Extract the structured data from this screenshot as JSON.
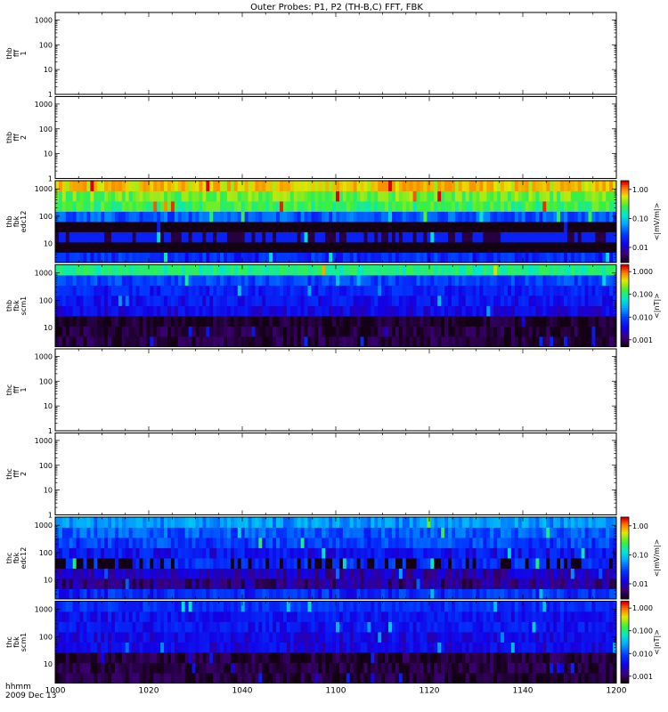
{
  "title": "Outer Probes: P1, P2 (TH-B,C) FFT, FBK",
  "footer": {
    "line1": "hhmm",
    "line2": "2009 Dec 13"
  },
  "chart_data": {
    "type": "heatmap",
    "x_ticks": [
      "1000",
      "1020",
      "1040",
      "1100",
      "1120",
      "1140",
      "1200"
    ],
    "y_scale": "log",
    "panels": [
      {
        "ylabel": [
          "thb",
          "fff",
          "1"
        ],
        "y_ticks": [
          "1",
          "10",
          "100",
          "1000"
        ],
        "ylim": [
          1,
          2000
        ],
        "has_data": false
      },
      {
        "ylabel": [
          "thb",
          "fff",
          "2"
        ],
        "y_ticks": [
          "1",
          "10",
          "100",
          "1000"
        ],
        "ylim": [
          1,
          2000
        ],
        "has_data": false
      },
      {
        "ylabel": [
          "thb",
          "fbk",
          "edc12"
        ],
        "y_ticks": [
          "10",
          "100",
          "1000"
        ],
        "ylim": [
          2,
          2000
        ],
        "has_data": true,
        "colorbar": {
          "label": "<|mV/m|>",
          "ticks": [
            "1.00",
            "0.10",
            "0.01"
          ],
          "range": [
            0.003,
            2
          ]
        },
        "bands": [
          {
            "level": 0.02,
            "pattern": "dark"
          },
          {
            "level": 0.0001,
            "pattern": "mid"
          },
          {
            "level": 0.02,
            "pattern": "purple"
          },
          {
            "level": 0.0001,
            "pattern": "mix"
          },
          {
            "level": 0.03,
            "pattern": "mid"
          },
          {
            "level": 0.25,
            "pattern": "bright"
          },
          {
            "level": 0.35,
            "pattern": "bright"
          },
          {
            "level": 0.7,
            "pattern": "bright"
          }
        ]
      },
      {
        "ylabel": [
          "thb",
          "fbk",
          "scm1"
        ],
        "y_ticks": [
          "10",
          "100",
          "1000"
        ],
        "ylim": [
          2,
          2000
        ],
        "has_data": true,
        "colorbar": {
          "label": "<|nT|>",
          "ticks": [
            "1.000",
            "0.100",
            "0.010",
            "0.001"
          ],
          "range": [
            0.0005,
            2
          ]
        },
        "bands": [
          {
            "level": 0.0006,
            "pattern": "dark"
          },
          {
            "level": 0.0006,
            "pattern": "dark"
          },
          {
            "level": 0.0005,
            "pattern": "dark"
          },
          {
            "level": 0.003,
            "pattern": "mid"
          },
          {
            "level": 0.004,
            "pattern": "mid"
          },
          {
            "level": 0.005,
            "pattern": "mid"
          },
          {
            "level": 0.008,
            "pattern": "mid"
          },
          {
            "level": 0.1,
            "pattern": "bright"
          }
        ]
      },
      {
        "ylabel": [
          "thc",
          "fff",
          "1"
        ],
        "y_ticks": [
          "1",
          "10",
          "100",
          "1000"
        ],
        "ylim": [
          1,
          2000
        ],
        "has_data": false
      },
      {
        "ylabel": [
          "thc",
          "fff",
          "2"
        ],
        "y_ticks": [
          "1",
          "10",
          "100",
          "1000"
        ],
        "ylim": [
          1,
          2000
        ],
        "has_data": false
      },
      {
        "ylabel": [
          "thc",
          "fbk",
          "edc12"
        ],
        "y_ticks": [
          "10",
          "100",
          "1000"
        ],
        "ylim": [
          2,
          2000
        ],
        "has_data": true,
        "colorbar": {
          "label": "<|mV/m|>",
          "ticks": [
            "1.00",
            "0.10",
            "0.01"
          ],
          "range": [
            0.003,
            2
          ]
        },
        "bands": [
          {
            "level": 0.02,
            "pattern": "dark"
          },
          {
            "level": 0.006,
            "pattern": "mid"
          },
          {
            "level": 0.008,
            "pattern": "mid"
          },
          {
            "level": 0.01,
            "pattern": "mix"
          },
          {
            "level": 0.015,
            "pattern": "mid"
          },
          {
            "level": 0.025,
            "pattern": "mid"
          },
          {
            "level": 0.03,
            "pattern": "mid"
          },
          {
            "level": 0.06,
            "pattern": "bright"
          }
        ]
      },
      {
        "ylabel": [
          "thc",
          "fbk",
          "scm1"
        ],
        "y_ticks": [
          "10",
          "100",
          "1000"
        ],
        "ylim": [
          2,
          2000
        ],
        "has_data": true,
        "colorbar": {
          "label": "<|nT|>",
          "ticks": [
            "1.000",
            "0.100",
            "0.010",
            "0.001"
          ],
          "range": [
            0.0005,
            2
          ]
        },
        "bands": [
          {
            "level": 0.0006,
            "pattern": "dark"
          },
          {
            "level": 0.0006,
            "pattern": "dark"
          },
          {
            "level": 0.0006,
            "pattern": "dark"
          },
          {
            "level": 0.003,
            "pattern": "mid"
          },
          {
            "level": 0.003,
            "pattern": "mid"
          },
          {
            "level": 0.004,
            "pattern": "mid"
          },
          {
            "level": 0.004,
            "pattern": "mid"
          },
          {
            "level": 0.006,
            "pattern": "mid"
          }
        ]
      }
    ]
  }
}
